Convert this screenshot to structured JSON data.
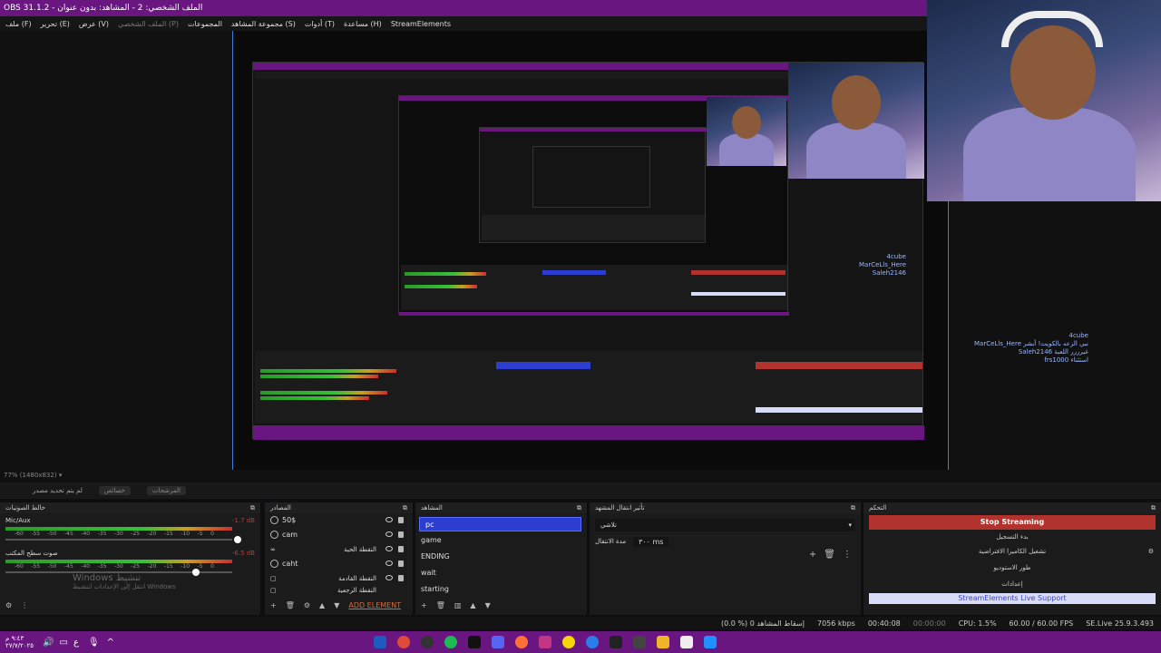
{
  "window": {
    "title": "OBS 31.1.2 - الملف الشخصي: 2 - المشاهد: بدون عنوان"
  },
  "menu": [
    {
      "label": "ملف (F)"
    },
    {
      "label": "تحرير (E)"
    },
    {
      "label": "عرض (V)"
    },
    {
      "label": "الملف الشخصي (P)"
    },
    {
      "label": "المجموعات"
    },
    {
      "label": "مجموعة المشاهد (S)"
    },
    {
      "label": "أدوات (T)"
    },
    {
      "label": "مساعدة (H)"
    },
    {
      "label": "StreamElements"
    }
  ],
  "preview": {
    "chat": {
      "line1": "4cube",
      "line2": "MarCeLls_Here  نبي الزعه بالكويت! أبشر",
      "line3": "Saleh2146  غيرررر اللعبة",
      "line4": "frs1000  استثناء"
    }
  },
  "zoom": {
    "label": "77% (1480x832)"
  },
  "modebar": {
    "left": "لم يتم تحديد مصدر",
    "btn1": "خصائص",
    "btn2": "المرشحات"
  },
  "audio": {
    "title": "خالط الصوتيات",
    "tracks": [
      {
        "name": "Mic/Aux",
        "db": "-1.7 dB"
      },
      {
        "name": "صوت سطح المكتب",
        "db": "-6.5 dB"
      }
    ],
    "ticks": [
      "-60",
      "-55",
      "-50",
      "-45",
      "-40",
      "-35",
      "-30",
      "-25",
      "-20",
      "-15",
      "-10",
      "-5",
      "0"
    ],
    "watermark1": "Windows تنشيط",
    "watermark2": "انتقل إلى الإعدادات لتنشيط Windows"
  },
  "sources": {
    "title": "المصادر",
    "items": [
      {
        "label": "50$",
        "tag": ""
      },
      {
        "label": "cam",
        "tag": ""
      },
      {
        "label": "",
        "tag": "النقطة الحية"
      },
      {
        "label": "caht",
        "tag": ""
      },
      {
        "label": "",
        "tag": "النقطة القادمة"
      },
      {
        "label": "",
        "tag": "النقطة الرجعية"
      }
    ],
    "add_element": "ADD ELEMENT"
  },
  "scenes": {
    "title": "المشاهد",
    "items": [
      "pc",
      "game",
      "ENDING",
      "wait",
      "starting"
    ],
    "selected": "pc"
  },
  "transitions": {
    "title": "تأثير انتقال المشهد",
    "type": "تلاشي",
    "duration_label": "مدة الانتقال",
    "duration_value": "٣٠٠ ms"
  },
  "controls": {
    "title": "التحكم",
    "buttons": [
      "Stop Streaming",
      "بدء التسجيل",
      "تشغيل الكاميرا الافتراضية",
      "طور الاستوديو",
      "إعدادات",
      "StreamElements Live Support"
    ]
  },
  "status": {
    "dropped": "(0.0 %) 0 إسقاط المشاهد",
    "bitrate": "7056 kbps",
    "stream_time": "00:40:08",
    "rec_time": "00:00:00",
    "cpu": "CPU: 1.5%",
    "fps": "60.00 / 60.00 FPS",
    "selive": "SE.Live 25.9.3.493"
  },
  "taskbar": {
    "time": "٩:٤٣ م",
    "date": "٢٧/٧/٢٠٢٥"
  },
  "colors": {
    "accent": "#6a1680",
    "stop": "#b2322e",
    "selection": "#2c3ed0"
  }
}
